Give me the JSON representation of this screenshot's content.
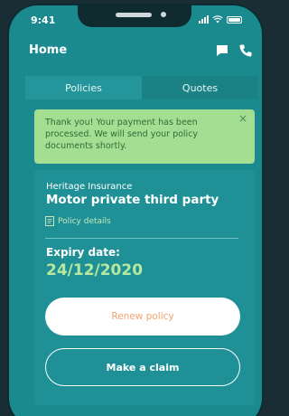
{
  "status_bar": {
    "time": "9:41",
    "icons": [
      "signal-icon",
      "wifi-icon",
      "battery-icon"
    ]
  },
  "header": {
    "title": "Home",
    "icons": [
      "chat-icon",
      "phone-icon"
    ]
  },
  "tabs": [
    {
      "label": "Policies",
      "selected": true
    },
    {
      "label": "Quotes",
      "selected": false
    }
  ],
  "alert": {
    "message": "Thank you! Your payment has been processed. We will send your policy documents shortly.",
    "close_glyph": "×",
    "color": "#a3de93"
  },
  "policy": {
    "insurer": "Heritage Insurance",
    "name": "Motor private third party",
    "details_link": "Policy details",
    "expiry_label": "Expiry date:",
    "expiry_date": "24/12/2020",
    "renew_label": "Renew policy",
    "claim_label": "Make a claim"
  },
  "colors": {
    "screen": "#1b8a8f",
    "card": "#1f9196",
    "accent_green": "#b7e89f",
    "renew_text": "#f3a36c"
  }
}
